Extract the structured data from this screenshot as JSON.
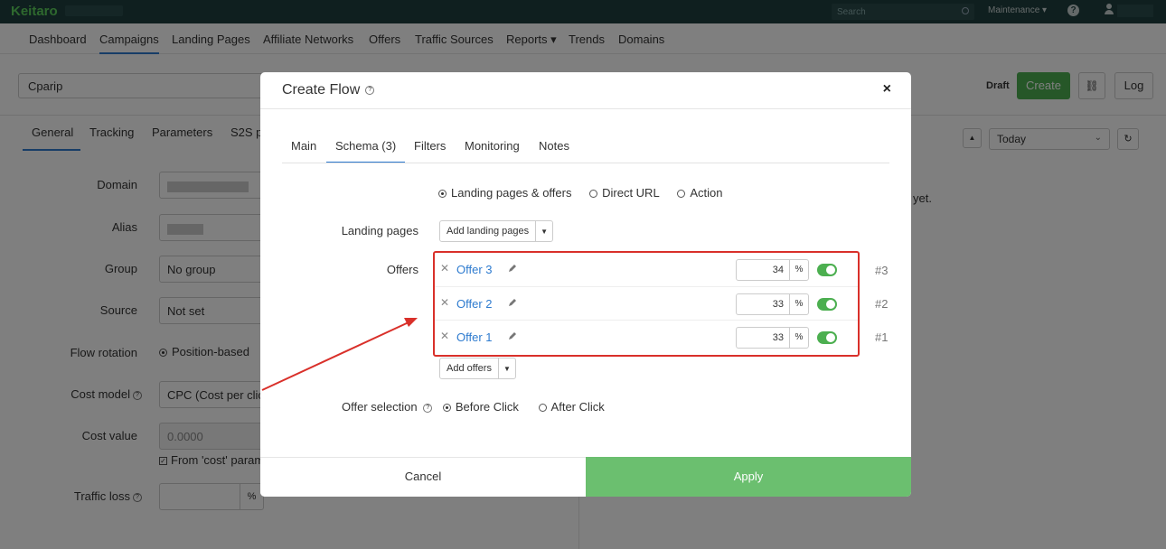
{
  "topbar": {
    "logo": "Keitaro",
    "search_placeholder": "Search",
    "maintenance": "Maintenance ▾",
    "help": "?"
  },
  "mainnav": [
    "Dashboard",
    "Campaigns",
    "Landing Pages",
    "Affiliate Networks",
    "Offers",
    "Traffic Sources",
    "Reports ▾",
    "Trends",
    "Domains"
  ],
  "campaign": {
    "name": "Cparip",
    "status": "Draft",
    "create_label": "Create",
    "link_icon": "⛓",
    "log_label": "Log"
  },
  "subtabs": [
    "General",
    "Tracking",
    "Parameters",
    "S2S p"
  ],
  "stats": {
    "date_range": "Today",
    "empty_text": "yet."
  },
  "form": {
    "domain_label": "Domain",
    "alias_label": "Alias",
    "group_label": "Group",
    "group_value": "No group",
    "source_label": "Source",
    "source_value": "Not set",
    "flow_rotation_label": "Flow rotation",
    "flow_rotation_value": "Position-based",
    "cost_model_label": "Cost model",
    "cost_model_value": "CPC (Cost per clic",
    "cost_value_label": "Cost value",
    "cost_value": "0.0000",
    "cost_param_label": "From 'cost' param",
    "traffic_loss_label": "Traffic loss",
    "traffic_loss_unit": "%"
  },
  "modal": {
    "title": "Create Flow",
    "close": "×",
    "tabs": [
      "Main",
      "Schema (3)",
      "Filters",
      "Monitoring",
      "Notes"
    ],
    "schema_options": [
      "Landing pages & offers",
      "Direct URL",
      "Action"
    ],
    "landing_pages_label": "Landing pages",
    "add_landing_pages": "Add landing pages",
    "offers_label": "Offers",
    "offers": [
      {
        "name": "Offer 3",
        "percent": "34",
        "num": "#3"
      },
      {
        "name": "Offer 2",
        "percent": "33",
        "num": "#2"
      },
      {
        "name": "Offer 1",
        "percent": "33",
        "num": "#1"
      }
    ],
    "percent_unit": "%",
    "add_offers": "Add offers",
    "offer_selection_label": "Offer selection",
    "offer_selection_options": [
      "Before Click",
      "After Click"
    ],
    "cancel_label": "Cancel",
    "apply_label": "Apply"
  },
  "colors": {
    "accent": "#2e7bcf",
    "success": "#4caf50",
    "highlight": "#d9302a"
  }
}
